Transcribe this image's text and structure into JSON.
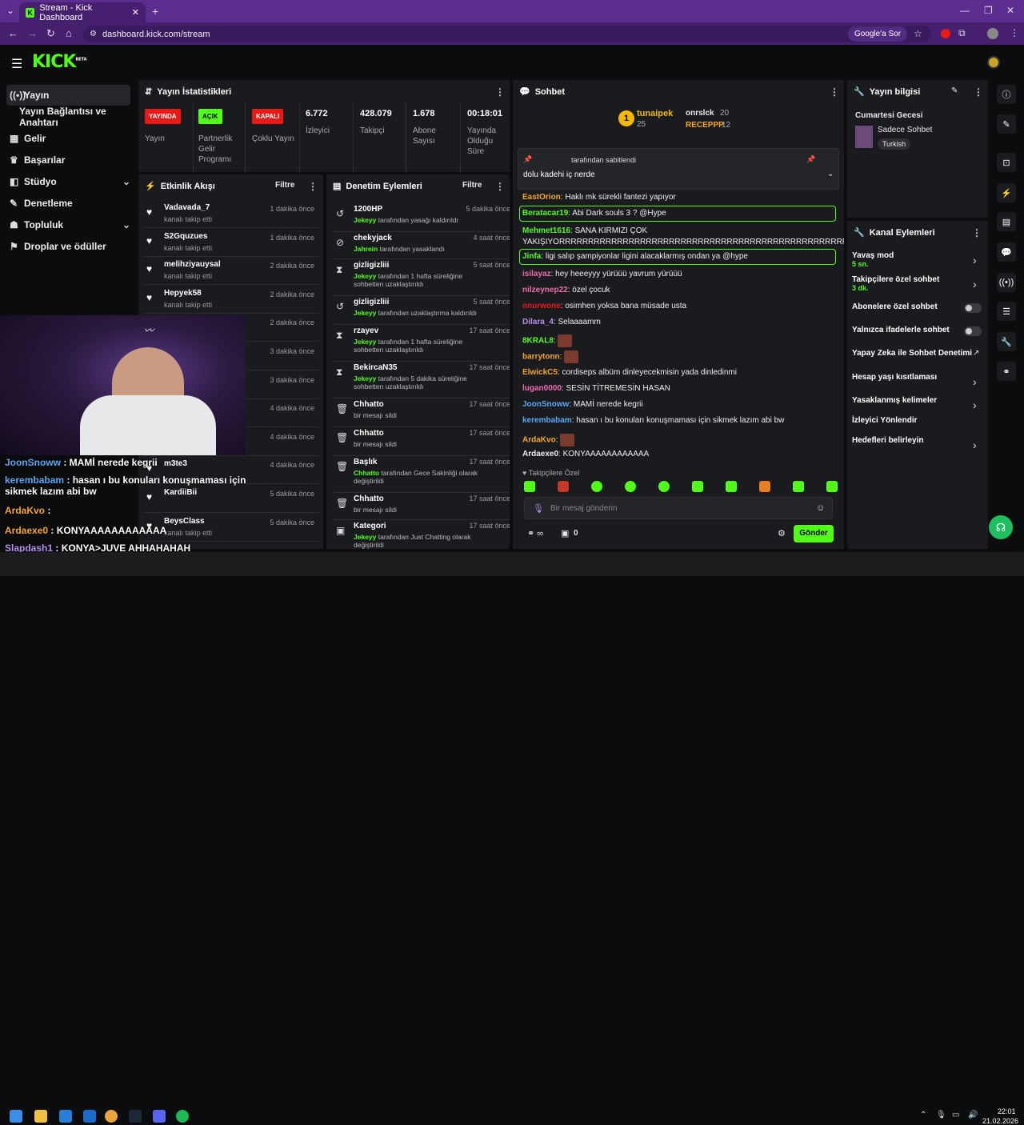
{
  "browser": {
    "tab_title": "Stream - Kick Dashboard",
    "url": "dashboard.kick.com/stream",
    "google_btn": "Google'a Sor"
  },
  "sidebar": {
    "items": [
      {
        "label": "Yayın",
        "icon": "broadcast-icon"
      },
      {
        "label": "Yayın Bağlantısı ve Anahtarı",
        "icon": ""
      },
      {
        "label": "Gelir",
        "icon": "income-icon"
      },
      {
        "label": "Başarılar",
        "icon": "trophy-icon"
      },
      {
        "label": "Stüdyo",
        "icon": "studio-icon"
      },
      {
        "label": "Denetleme",
        "icon": "wrench-icon"
      },
      {
        "label": "Topluluk",
        "icon": "community-icon"
      },
      {
        "label": "Droplar ve ödüller",
        "icon": "drops-icon"
      }
    ]
  },
  "stats": {
    "title": "Yayın İstatistikleri",
    "badges": [
      {
        "text": "YAYINDA",
        "label": "Yayın",
        "color": "#e91916"
      },
      {
        "text": "AÇIK",
        "label": "Partnerlik Gelir Programı",
        "color": "#53fc18"
      },
      {
        "text": "KAPALI",
        "label": "Çoklu Yayın",
        "color": "#e91916"
      }
    ],
    "values": [
      {
        "v": "6.772",
        "label": "İzleyici"
      },
      {
        "v": "428.079",
        "label": "Takipçi"
      },
      {
        "v": "1.678",
        "label": "Abone Sayısı"
      },
      {
        "v": "00:18:01",
        "label": "Yayında Olduğu Süre"
      }
    ]
  },
  "activity": {
    "title": "Etkinlik Akışı",
    "filter": "Filtre",
    "rows": [
      {
        "name": "Vadavada_7",
        "sub": "kanalı takip etti",
        "time": "1 dakika önce"
      },
      {
        "name": "S2Gquzues",
        "sub": "kanalı takip etti",
        "time": "1 dakika önce"
      },
      {
        "name": "melihziyauysal",
        "sub": "kanalı takip etti",
        "time": "2 dakika önce"
      },
      {
        "name": "Hepyek58",
        "sub": "kanalı takip etti",
        "time": "2 dakika önce"
      },
      {
        "name": "ne",
        "sub": "",
        "time": "2 dakika önce"
      },
      {
        "name": "",
        "sub": "",
        "time": "3 dakika önce"
      },
      {
        "name": "",
        "sub": "",
        "time": "3 dakika önce"
      },
      {
        "name": "",
        "sub": "",
        "time": "4 dakika önce"
      },
      {
        "name": "",
        "sub": "kanalı takip etti",
        "time": "4 dakika önce"
      },
      {
        "name": "m3te3",
        "sub": "",
        "time": "4 dakika önce"
      },
      {
        "name": "KardiiBii",
        "sub": "",
        "time": "5 dakika önce"
      },
      {
        "name": "BeysClass",
        "sub": "kanalı takip etti",
        "time": "5 dakika önce"
      }
    ]
  },
  "moderation": {
    "title": "Denetim Eylemleri",
    "filter": "Filtre",
    "rows": [
      {
        "icon": "undo-icon",
        "name": "1200HP",
        "by": "Jekeyy",
        "desc": " tarafından yasağı kaldırıldı",
        "time": "5 dakika önce"
      },
      {
        "icon": "ban-icon",
        "name": "chekyjack",
        "by": "Jahrein",
        "desc": " tarafından yasaklandı",
        "time": "4 saat önce"
      },
      {
        "icon": "hourglass-icon",
        "name": "gizligizliii",
        "by": "Jekeyy",
        "desc": " tarafından 1 hafta süreliğine sohbetten uzaklaştırıldı",
        "time": "5 saat önce"
      },
      {
        "icon": "undo-icon",
        "name": "gizligizliii",
        "by": "Jekeyy",
        "desc": " tarafından uzaklaştırma kaldırıldı",
        "time": "5 saat önce"
      },
      {
        "icon": "hourglass-icon",
        "name": "rzayev",
        "by": "Jekeyy",
        "desc": " tarafından 1 hafta süreliğine sohbetten uzaklaştırıldı",
        "time": "17 saat önce"
      },
      {
        "icon": "hourglass-icon",
        "name": "BekircaN35",
        "by": "Jekeyy",
        "desc": " tarafından 5 dakika süreliğine sohbetten uzaklaştırıldı",
        "time": "17 saat önce"
      },
      {
        "icon": "trash-icon",
        "name": "Chhatto",
        "by": "",
        "desc": "bir mesajı sildi",
        "time": "17 saat önce"
      },
      {
        "icon": "trash-icon",
        "name": "Chhatto",
        "by": "",
        "desc": "bir mesajı sildi",
        "time": "17 saat önce"
      },
      {
        "icon": "trash-icon",
        "name": "Başlık",
        "by": "Chhatto",
        "desc": " tarafından Gece Sakinliği olarak değiştirildi",
        "time": "17 saat önce"
      },
      {
        "icon": "trash-icon",
        "name": "Chhatto",
        "by": "",
        "desc": "bir mesajı sildi",
        "time": "17 saat önce"
      },
      {
        "icon": "category-icon",
        "name": "Kategori",
        "by": "Jekeyy",
        "desc": " tarafından Just Chatting olarak değiştirildi",
        "time": "17 saat önce"
      }
    ]
  },
  "chat": {
    "title": "Sohbet",
    "leaders": [
      {
        "rank": "1",
        "name": "tunaipek",
        "count": "25"
      },
      {
        "name": "onrslck",
        "count": "20"
      },
      {
        "name": "RECEPPP",
        "count": "12"
      }
    ],
    "pinned_by": "tarafından sabitlendi",
    "pinned_text": "dolu kadehi iç nerde",
    "messages": [
      {
        "user": "EastOrion",
        "color": "#f5a623",
        "text": "Haklı mk sürekli fantezi yapıyor",
        "hl": false
      },
      {
        "user": "Beratacar19",
        "color": "#53fc18",
        "text": "Abi Dark souls 3 ? @Hype",
        "hl": true
      },
      {
        "user": "Mehmet1616",
        "color": "#53fc18",
        "text": "SANA KIRMIZI ÇOK",
        "hl": false
      },
      {
        "user": "",
        "color": "#eee",
        "text": "YAKIŞIYORRRRRRRRRRRRRRRRRRRRRRRRRRRRRRRRRRRRRRRRRRRRRRRRRRRRRR",
        "hl": false
      },
      {
        "user": "Jinfa",
        "color": "#53fc18",
        "text": "ligi salıp şampiyonlar ligini alacaklarmış ondan ya @hype",
        "hl": true
      },
      {
        "user": "isilayaz",
        "color": "#f06bb0",
        "text": "hey heeeyyy yürüüü yavrum yürüüü",
        "hl": false
      },
      {
        "user": "nilzeynep22",
        "color": "#f06bb0",
        "text": "özel çocuk",
        "hl": false
      },
      {
        "user": "onurwone",
        "color": "#e91916",
        "text": "osimhen yoksa bana müsade usta",
        "hl": false
      },
      {
        "user": "Dilara_4",
        "color": "#b98cf0",
        "text": "Selaaaamm",
        "hl": false
      },
      {
        "user": "8KRAL8",
        "color": "#53fc18",
        "text": "",
        "hl": false
      },
      {
        "user": "barrytonn",
        "color": "#f5a623",
        "text": "",
        "hl": false
      },
      {
        "user": "ElwickC5",
        "color": "#f5a623",
        "text": "cordiseps albüm dinleyecekmisin yada dinledinmi",
        "hl": false
      },
      {
        "user": "lugan0000",
        "color": "#f06bb0",
        "text": "SESİN TİTREMESİN HASAN",
        "hl": false
      },
      {
        "user": "JoonSnoww",
        "color": "#5aa8f5",
        "text": "MAMİ nerede kegrii",
        "hl": false
      },
      {
        "user": "kerembabam",
        "color": "#5aa8f5",
        "text": "hasan ı bu konuları konuşmaması için sikmek lazım abi bw",
        "hl": false
      },
      {
        "user": "ArdaKvo",
        "color": "#f5a623",
        "text": "",
        "hl": false
      },
      {
        "user": "Ardaexe0",
        "color": "#eee",
        "text": "KONYAAAAAAAAAAAA",
        "hl": false
      }
    ],
    "followers_only": "Takipçilere Özel",
    "input_placeholder": "Bir mesaj gönderin",
    "send": "Gönder",
    "points": "0"
  },
  "stream_info": {
    "title": "Yayın bilgisi",
    "stream_title": "Cumartesi Gecesi",
    "category": "Sadece Sohbet",
    "tag": "Turkish"
  },
  "channel_actions": {
    "title": "Kanal Eylemleri",
    "items": [
      {
        "label": "Yavaş mod",
        "sub": "5 sn.",
        "type": "chevron"
      },
      {
        "label": "Takipçilere özel sohbet",
        "sub": "3 dk.",
        "type": "chevron"
      },
      {
        "label": "Abonelere özel sohbet",
        "sub": "",
        "type": "toggle"
      },
      {
        "label": "Yalnızca ifadelerle sohbet",
        "sub": "",
        "type": "toggle"
      },
      {
        "label": "Yapay Zeka ile Sohbet Denetimi",
        "sub": "",
        "type": "ext"
      },
      {
        "label": "Hesap yaşı kısıtlaması",
        "sub": "",
        "type": "chevron"
      },
      {
        "label": "Yasaklanmış kelimeler",
        "sub": "",
        "type": "chevron"
      },
      {
        "label": "İzleyici Yönlendir",
        "sub": "",
        "type": "none"
      },
      {
        "label": "Hedefleri belirleyin",
        "sub": "",
        "type": "chevron"
      }
    ]
  },
  "overlay_chat": [
    {
      "user": "JoonSnoww",
      "color": "#5aa8f5",
      "text": " : MAMİ nerede kegrii"
    },
    {
      "user": "kerembabam",
      "color": "#5aa8f5",
      "text": " : hasan ı bu konuları konuşmaması için sikmek lazım abi bw"
    },
    {
      "user": "ArdaKvo",
      "color": "#f5a623",
      "text": " :"
    },
    {
      "user": "Ardaexe0",
      "color": "#f5a623",
      "text": " : KONYAAAAAAAAAAAA"
    },
    {
      "user": "Slapdash1",
      "color": "#b98cf0",
      "text": " : KONYA>JUVE AHHAHAHAH"
    }
  ],
  "taskbar": {
    "time": "22:01",
    "date": "21.02.2026"
  }
}
